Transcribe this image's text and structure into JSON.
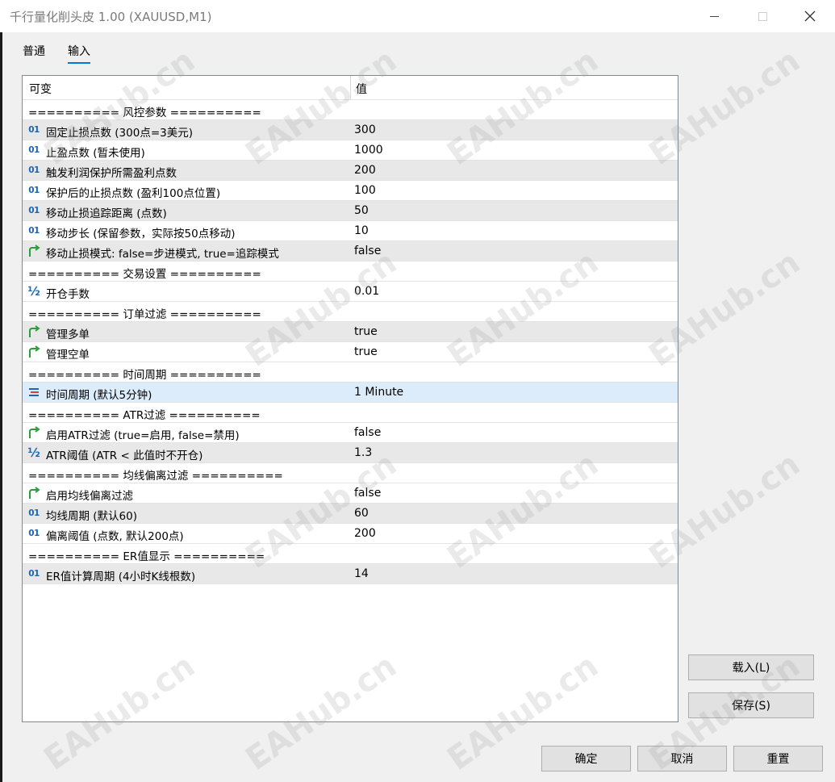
{
  "window": {
    "title": "千行量化削头皮 1.00 (XAUUSD,M1)"
  },
  "tabs": [
    {
      "label": "普通"
    },
    {
      "label": "输入"
    }
  ],
  "grid": {
    "col_variable": "可变",
    "col_value": "值",
    "rows": [
      {
        "type": "section",
        "name": "========== 风控参数 ==========",
        "value": ""
      },
      {
        "type": "int",
        "name": "固定止损点数 (300点=3美元)",
        "value": "300"
      },
      {
        "type": "int",
        "name": "止盈点数 (暂未使用)",
        "value": "1000"
      },
      {
        "type": "int",
        "name": "触发利润保护所需盈利点数",
        "value": "200"
      },
      {
        "type": "int",
        "name": "保护后的止损点数 (盈利100点位置)",
        "value": "100"
      },
      {
        "type": "int",
        "name": "移动止损追踪距离 (点数)",
        "value": "50"
      },
      {
        "type": "int",
        "name": "移动步长 (保留参数，实际按50点移动)",
        "value": "10"
      },
      {
        "type": "bool",
        "name": "移动止损模式: false=步进模式, true=追踪模式",
        "value": "false"
      },
      {
        "type": "section",
        "name": "========== 交易设置 ==========",
        "value": ""
      },
      {
        "type": "double",
        "name": "开仓手数",
        "value": "0.01"
      },
      {
        "type": "section",
        "name": "========== 订单过滤 ==========",
        "value": ""
      },
      {
        "type": "bool",
        "name": "管理多单",
        "value": "true"
      },
      {
        "type": "bool",
        "name": "管理空单",
        "value": "true"
      },
      {
        "type": "section",
        "name": "========== 时间周期 ==========",
        "value": ""
      },
      {
        "type": "enum",
        "name": "时间周期 (默认5分钟)",
        "value": "1 Minute"
      },
      {
        "type": "section",
        "name": "========== ATR过滤 ==========",
        "value": ""
      },
      {
        "type": "bool",
        "name": "启用ATR过滤 (true=启用, false=禁用)",
        "value": "false"
      },
      {
        "type": "double",
        "name": "ATR阈值 (ATR < 此值时不开仓)",
        "value": "1.3"
      },
      {
        "type": "section",
        "name": "========== 均线偏离过滤 ==========",
        "value": ""
      },
      {
        "type": "bool",
        "name": "启用均线偏离过滤",
        "value": "false"
      },
      {
        "type": "int",
        "name": "均线周期 (默认60)",
        "value": "60"
      },
      {
        "type": "int",
        "name": "偏离阈值 (点数, 默认200点)",
        "value": "200"
      },
      {
        "type": "section",
        "name": "========== ER值显示 ==========",
        "value": ""
      },
      {
        "type": "int",
        "name": "ER值计算周期 (4小时K线根数)",
        "value": "14"
      }
    ]
  },
  "buttons": {
    "load": "载入(L)",
    "save": "保存(S)",
    "ok": "确定",
    "cancel": "取消",
    "reset": "重置"
  },
  "watermark": "EAHub.cn",
  "colors": {
    "accent": "#0078d7",
    "row_gray": "#e8e8e8",
    "row_selected": "#dcecfa",
    "int_icon": "#1c64b4",
    "bool_icon": "#2a9d3c"
  }
}
